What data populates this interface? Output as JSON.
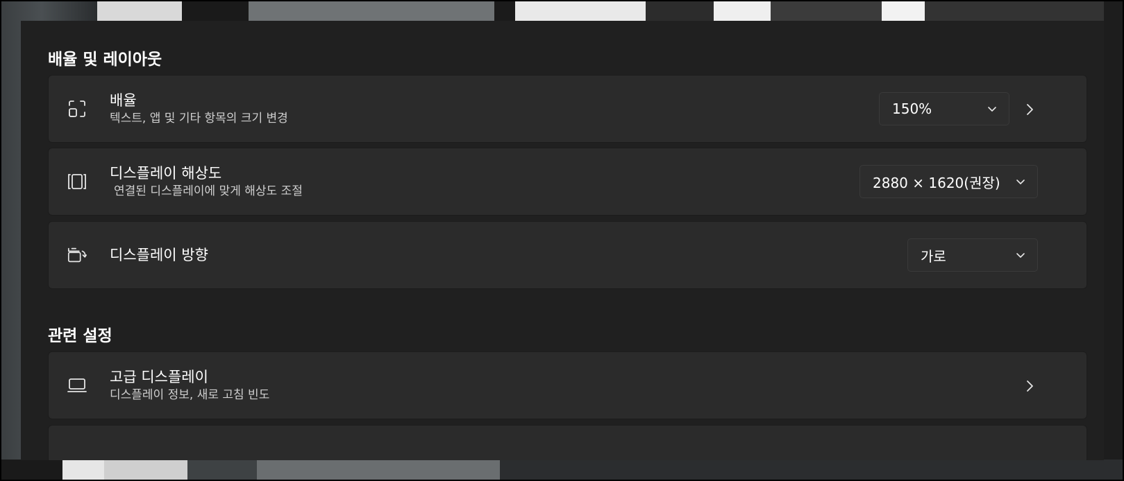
{
  "sections": {
    "layout_title": "배율 및 레이아웃",
    "related_title": "관련 설정"
  },
  "scale": {
    "title": "배율",
    "subtitle": "텍스트, 앱 및 기타 항목의 크기 변경",
    "value": "150%",
    "icon": "scale-icon"
  },
  "resolution": {
    "title": "디스플레이 해상도",
    "subtitle": "연결된 디스플레이에 맞게 해상도 조절",
    "value": "2880 × 1620(권장)",
    "icon": "resolution-icon"
  },
  "orientation": {
    "title": "디스플레이 방향",
    "value": "가로",
    "icon": "orientation-icon"
  },
  "advanced": {
    "title": "고급 디스플레이",
    "subtitle": "디스플레이 정보, 새로 고침 빈도",
    "icon": "monitor-icon"
  },
  "colors": {
    "panel_bg": "#202020",
    "card_bg": "#2b2b2b",
    "text": "#ffffff",
    "subtext": "#cfcfcf"
  }
}
